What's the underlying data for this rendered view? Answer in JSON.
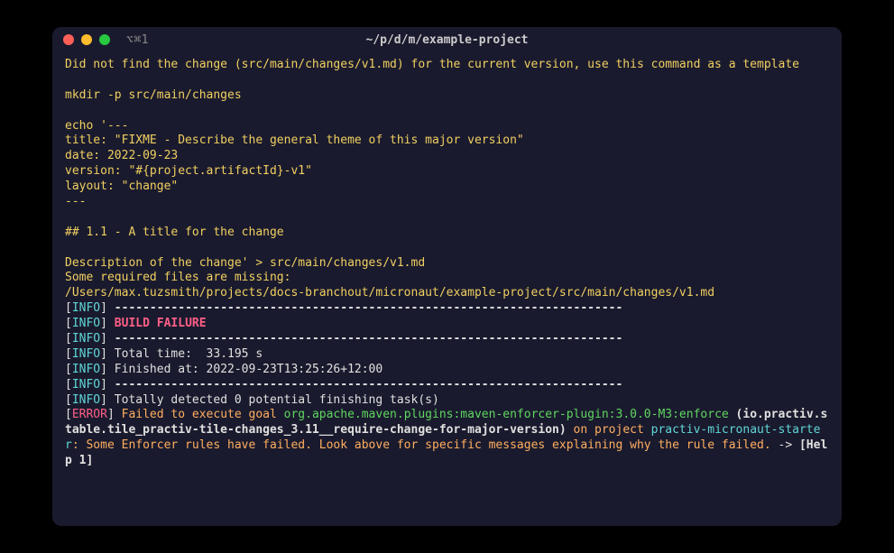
{
  "titlebar": {
    "tab_label": "⌥⌘1",
    "window_title": "~/p/d/m/example-project"
  },
  "log": {
    "warn_no_change": "Did not find the change (src/main/changes/v1.md) for the current version, use this command as a template",
    "mkdir": "mkdir -p src/main/changes",
    "echo1": "echo '---",
    "echo2": "title: \"FIXME - Describe the general theme of this major version\"",
    "echo3": "date: 2022-09-23",
    "echo4": "version: \"#{project.artifactId}-v1\"",
    "echo5": "layout: \"change\"",
    "echo6": "---",
    "echo7": "## 1.1 - A title for the change",
    "echo8": "Description of the change' > src/main/changes/v1.md",
    "missing1": "Some required files are missing:",
    "missing2": "/Users/max.tuzsmith/projects/docs-branchout/micronaut/example-project/src/main/changes/v1.md",
    "dashes": "------------------------------------------------------------------------",
    "build_failure": "BUILD FAILURE",
    "total_time": "Total time:  33.195 s",
    "finished_at": "Finished at: 2022-09-23T13:25:26+12:00",
    "totally_detected": "Totally detected 0 potential finishing task(s)",
    "info_tag": "INFO",
    "error_tag": "ERROR",
    "bracket_open": "[",
    "bracket_close": "] ",
    "err_failed": "Failed to execute goal ",
    "err_goal": "org.apache.maven.plugins:maven-enforcer-plugin:3.0.0-M3:enforce ",
    "err_exec_open": "(",
    "err_exec_id": "io.practiv.stable.tile_practiv-tile-changes_3.11__require-change-for-major-version",
    "err_exec_close": ") ",
    "err_on_project": "on project ",
    "err_project_name": "practiv-micronaut-starter",
    "err_colon": ": ",
    "err_msg": "Some Enforcer rules have failed. Look above for specific messages explaining why the rule failed.",
    "err_arrow": " -> ",
    "err_help": "[Help 1]"
  }
}
